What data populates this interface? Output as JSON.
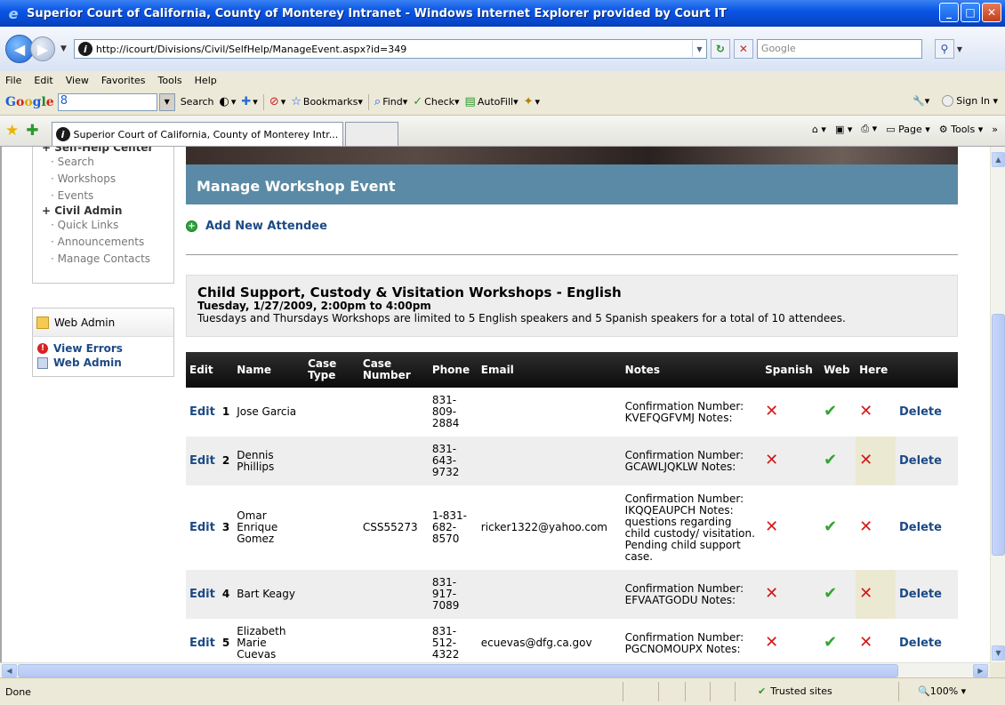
{
  "window": {
    "title": "Superior Court of California, County of Monterey Intranet - Windows Internet Explorer provided by Court IT"
  },
  "address": {
    "url": "http://icourt/Divisions/Civil/SelfHelp/ManageEvent.aspx?id=349",
    "search_placeholder": "Google"
  },
  "menu": [
    "File",
    "Edit",
    "View",
    "Favorites",
    "Tools",
    "Help"
  ],
  "google_toolbar": {
    "search_label": "Search",
    "bookmarks": "Bookmarks",
    "find": "Find",
    "check": "Check",
    "autofill": "AutoFill",
    "sign_in": "Sign In"
  },
  "tabs": {
    "active_title": "Superior Court of California, County of Monterey Intr...",
    "page_menu": "Page",
    "tools_menu": "Tools"
  },
  "sidebar": {
    "group1": "+ Self-Help Center",
    "group1_items": [
      "Search",
      "Workshops",
      "Events"
    ],
    "group2": "+ Civil Admin",
    "group2_items": [
      "Quick Links",
      "Announcements",
      "Manage Contacts"
    ],
    "web_admin_header": "Web Admin",
    "links": [
      "View Errors",
      "Web Admin"
    ]
  },
  "main": {
    "heading": "Manage Workshop Event",
    "add_attendee": "Add New Attendee",
    "event": {
      "title": "Child Support, Custody & Visitation Workshops - English",
      "datetime": "Tuesday, 1/27/2009, 2:00pm to 4:00pm",
      "note": "Tuesdays and Thursdays Workshops are limited to 5 English speakers and 5 Spanish speakers for a total of 10 attendees."
    }
  },
  "table": {
    "headers": [
      "Edit",
      "",
      "Name",
      "Case Type",
      "Case Number",
      "Phone",
      "Email",
      "Notes",
      "Spanish",
      "Web",
      "Here",
      ""
    ],
    "edit_label": "Edit",
    "delete_label": "Delete",
    "rows": [
      {
        "num": "1",
        "name": "Jose Garcia",
        "case_type": "",
        "case_number": "",
        "phone": "831-809-2884",
        "email": "",
        "notes": "Confirmation Number: KVEFQGFVMJ Notes:",
        "spanish": false,
        "web": true,
        "here": false
      },
      {
        "num": "2",
        "name": "Dennis Phillips",
        "case_type": "",
        "case_number": "",
        "phone": "831-643-9732",
        "email": "",
        "notes": "Confirmation Number: GCAWLJQKLW Notes:",
        "spanish": false,
        "web": true,
        "here": false
      },
      {
        "num": "3",
        "name": "Omar Enrique Gomez",
        "case_type": "",
        "case_number": "CSS55273",
        "phone": "1-831-682-8570",
        "email": "ricker1322@yahoo.com",
        "notes": "Confirmation Number: IKQQEAUPCH Notes: questions regarding child custody/ visitation. Pending child support case.",
        "spanish": false,
        "web": true,
        "here": false
      },
      {
        "num": "4",
        "name": "Bart Keagy",
        "case_type": "",
        "case_number": "",
        "phone": "831-917-7089",
        "email": "",
        "notes": "Confirmation Number: EFVAATGODU Notes:",
        "spanish": false,
        "web": true,
        "here": false
      },
      {
        "num": "5",
        "name": "Elizabeth Marie Cuevas",
        "case_type": "",
        "case_number": "",
        "phone": "831-512-4322",
        "email": "ecuevas@dfg.ca.gov",
        "notes": "Confirmation Number: PGCNOMOUPX Notes:",
        "spanish": false,
        "web": true,
        "here": false
      }
    ]
  },
  "status": {
    "text": "Done",
    "zone": "Trusted sites",
    "zoom": "100%"
  },
  "colors": {
    "heading_band": "#5b8aa6",
    "link": "#1c4a85",
    "cross": "#d21919",
    "check": "#33a532"
  }
}
